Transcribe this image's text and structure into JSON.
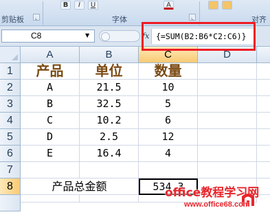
{
  "ribbon": {
    "groups": [
      {
        "label": "剪贴板",
        "launcher": "⌞"
      },
      {
        "label": "字体",
        "launcher": "⌞"
      },
      {
        "label": "对齐方",
        "launcher": ""
      }
    ],
    "buttons": [
      "B",
      "I",
      "U",
      "A"
    ]
  },
  "formula_bar": {
    "name_box": "C8",
    "fx_label": "fx",
    "formula": "{=SUM(B2:B6*C2:C6)}"
  },
  "columns": [
    "A",
    "B",
    "C",
    "D"
  ],
  "selected_column": "C",
  "rows": [
    "1",
    "2",
    "3",
    "4",
    "5",
    "6",
    "7",
    "8"
  ],
  "selected_row": "8",
  "table": {
    "header": {
      "a": "产品",
      "b": "单位",
      "c": "数量"
    },
    "data": [
      {
        "a": "A",
        "b": "21.5",
        "c": "10"
      },
      {
        "a": "B",
        "b": "32.5",
        "c": "5"
      },
      {
        "a": "C",
        "b": "10.2",
        "c": "6"
      },
      {
        "a": "D",
        "b": "2.5",
        "c": "12"
      },
      {
        "a": "E",
        "b": "16.4",
        "c": "4"
      }
    ],
    "total_label": "产品总金额",
    "total_value": "534.3"
  },
  "watermark": {
    "title": "office教程学习网",
    "url": "www.office68.com"
  },
  "colors": {
    "highlight": "#ee1c24",
    "header_text": "#7a4a13",
    "watermark": "#e8262c"
  }
}
